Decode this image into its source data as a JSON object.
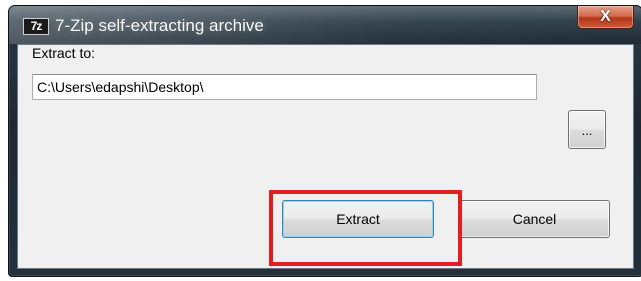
{
  "window": {
    "title": "7-Zip self-extracting archive",
    "app_icon_text": "7z",
    "close_label": "X"
  },
  "dialog": {
    "extract_to_label": "Extract to:",
    "path_value": "C:\\Users\\edapshi\\Desktop\\",
    "browse_label": "...",
    "extract_label": "Extract",
    "cancel_label": "Cancel"
  },
  "annotation": {
    "highlight_color": "#e41e1e",
    "highlight_target": "extract-button"
  }
}
